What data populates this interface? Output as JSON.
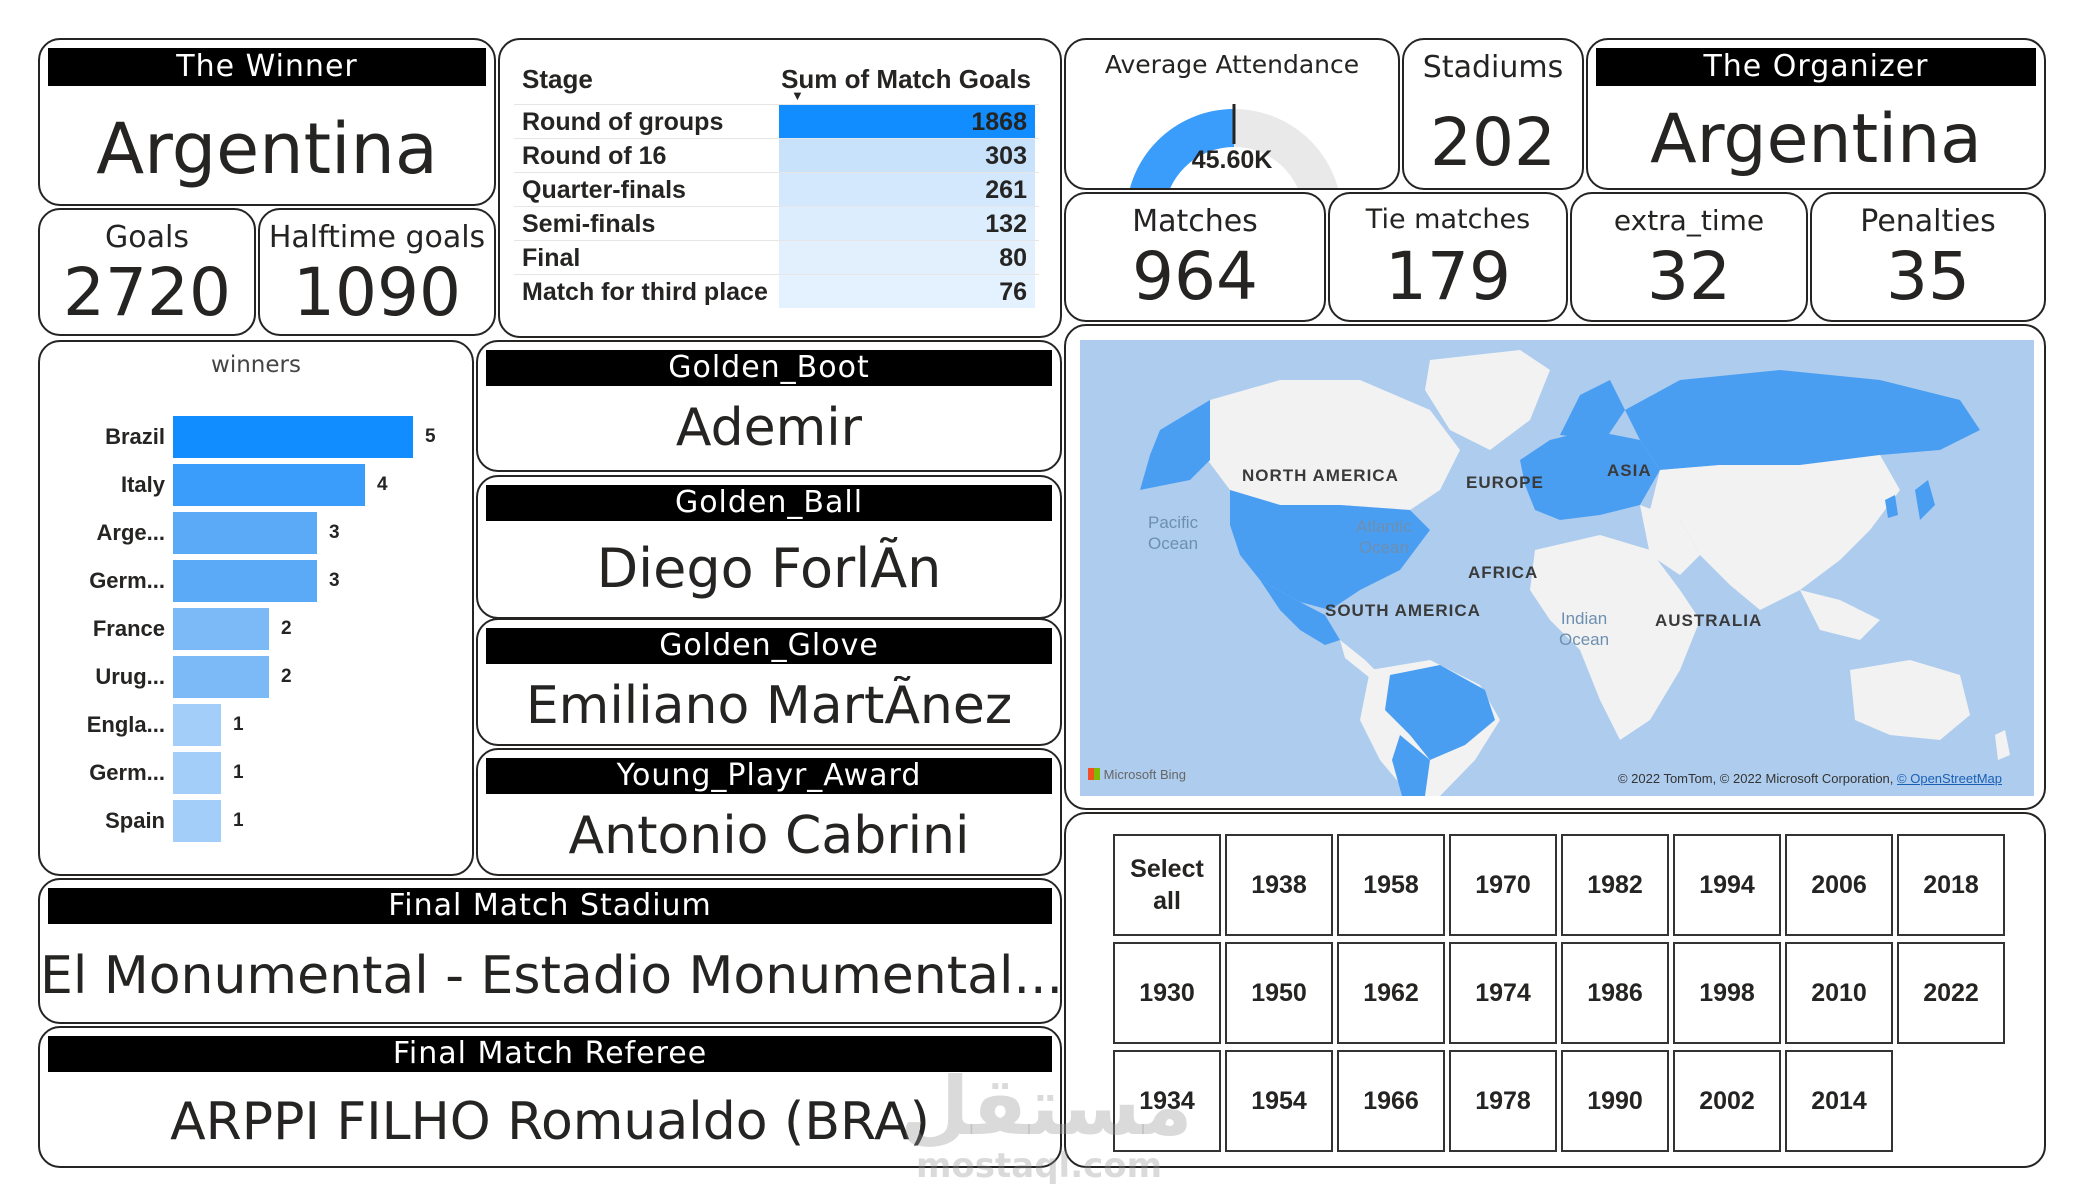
{
  "winner": {
    "title": "The Winner",
    "value": "Argentina"
  },
  "goals": {
    "label": "Goals",
    "value": "2720"
  },
  "halftime_goals": {
    "label": "Halftime goals",
    "value": "1090"
  },
  "stage_table": {
    "col_stage": "Stage",
    "col_goals": "Sum of Match Goals",
    "rows": [
      {
        "stage": "Round of groups",
        "goals": "1868"
      },
      {
        "stage": "Round of 16",
        "goals": "303"
      },
      {
        "stage": "Quarter-finals",
        "goals": "261"
      },
      {
        "stage": "Semi-finals",
        "goals": "132"
      },
      {
        "stage": "Final",
        "goals": "80"
      },
      {
        "stage": "Match for third place",
        "goals": "76"
      }
    ]
  },
  "attendance": {
    "label": "Average Attendance",
    "value_text": "45.60K",
    "gauge_fill": 0.5
  },
  "stadiums": {
    "label": "Stadiums",
    "value": "202"
  },
  "organizer": {
    "title": "The Organizer",
    "value": "Argentina"
  },
  "matches": {
    "label": "Matches",
    "value": "964"
  },
  "tie_matches": {
    "label": "Tie matches",
    "value": "179"
  },
  "extra_time": {
    "label": "extra_time",
    "value": "32"
  },
  "penalties": {
    "label": "Penalties",
    "value": "35"
  },
  "chart_data": {
    "type": "bar",
    "title": "winners",
    "categories": [
      "Brazil",
      "Italy",
      "Arge...",
      "Germ...",
      "France",
      "Urug...",
      "Engla...",
      "Germ...",
      "Spain"
    ],
    "values": [
      5,
      4,
      3,
      3,
      2,
      2,
      1,
      1,
      1
    ],
    "colors": [
      "#118DFF",
      "#3A9CFB",
      "#5AAAF8",
      "#5AAAF8",
      "#7BBAF7",
      "#7BBAF7",
      "#A3CEF9",
      "#A3CEF9",
      "#A3CEF9"
    ],
    "xlim": [
      0,
      5
    ]
  },
  "awards": {
    "golden_boot": {
      "title": "Golden_Boot",
      "value": "Ademir"
    },
    "golden_ball": {
      "title": "Golden_Ball",
      "value": "Diego ForlÃ­n"
    },
    "golden_glove": {
      "title": "Golden_Glove",
      "value": "Emiliano MartÃ­nez"
    },
    "young_player": {
      "title": "Young_Playr_Award",
      "value": "Antonio Cabrini"
    }
  },
  "final_stadium": {
    "title": "Final Match Stadium",
    "value": "El Monumental - Estadio Monumental..."
  },
  "final_referee": {
    "title": "Final Match Referee",
    "value": "ARPPI FILHO Romualdo (BRA)"
  },
  "map": {
    "labels": {
      "north_america": "NORTH AMERICA",
      "south_america": "SOUTH AMERICA",
      "europe": "EUROPE",
      "asia": "ASIA",
      "africa": "AFRICA",
      "australia": "AUSTRALIA",
      "pacific_line1": "Pacific",
      "pacific_line2": "Ocean",
      "atlantic_line1": "Atlantic",
      "atlantic_line2": "Ocean",
      "indian_line1": "Indian",
      "indian_line2": "Ocean"
    },
    "bing": "Microsoft Bing",
    "attribution": "© 2022 TomTom, © 2022 Microsoft Corporation,",
    "attribution_link": "© OpenStreetMap",
    "colors": {
      "ocean": "#AECDEE",
      "land": "#F2F2F2",
      "highlight": "#4A9EF2"
    }
  },
  "year_slicer": {
    "rows": [
      [
        "Select all",
        "1938",
        "1958",
        "1970",
        "1982",
        "1994",
        "2006",
        "2018"
      ],
      [
        "1930",
        "1950",
        "1962",
        "1974",
        "1986",
        "1998",
        "2010",
        "2022"
      ],
      [
        "1934",
        "1954",
        "1966",
        "1978",
        "1990",
        "2002",
        "2014"
      ]
    ]
  },
  "watermark": {
    "arabic": "مستقل",
    "latin": "mostaql.com"
  }
}
